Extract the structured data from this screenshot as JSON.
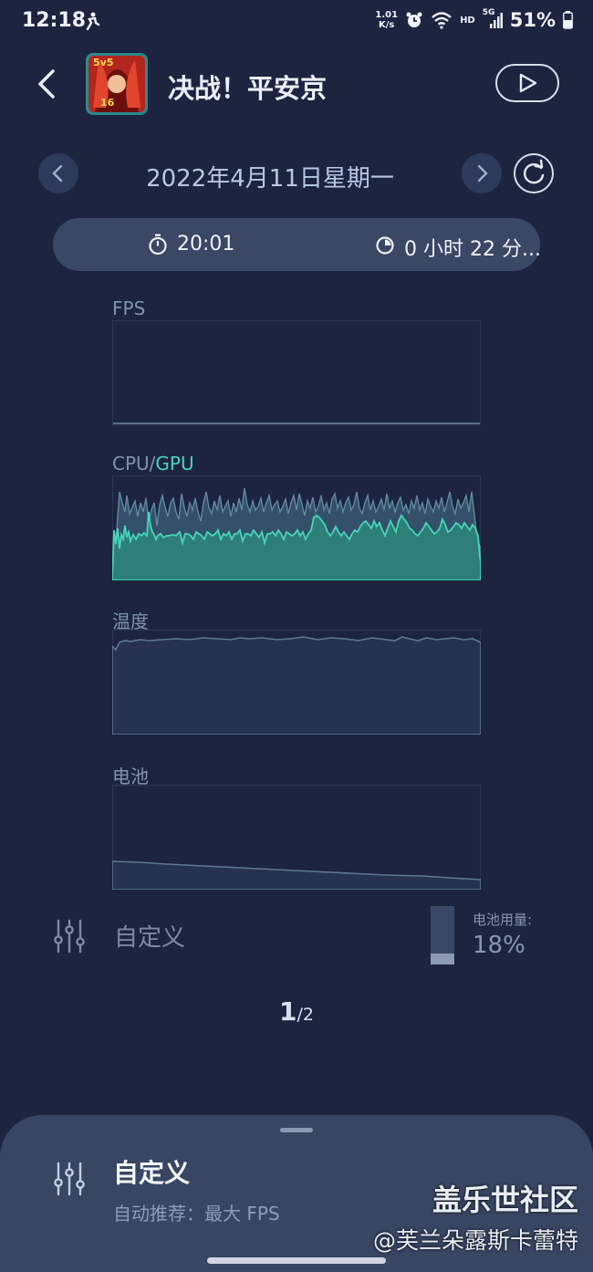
{
  "status_bar": {
    "time": "12:18",
    "net_speed_value": "1.01",
    "net_speed_unit": "K/s",
    "hd": "HD",
    "signal": "5G",
    "battery_percent": "51%"
  },
  "header": {
    "app_title": "决战！平安京",
    "icon_badge_top": "5v5",
    "icon_badge_bottom": "16"
  },
  "date_nav": {
    "date": "2022年4月11日星期一"
  },
  "session": {
    "start_time": "20:01",
    "duration": "0 小时 22 分..."
  },
  "charts": {
    "fps_label": "FPS",
    "cpu_label": "CPU",
    "gpu_separator": "/",
    "gpu_label": "GPU",
    "temp_label": "温度",
    "battery_label": "电池"
  },
  "customize": {
    "label": "自定义",
    "battery_usage_label": "电池用量:",
    "battery_usage_value": "18%",
    "battery_usage_fraction": 0.18
  },
  "pager": {
    "current": "1",
    "total": "/2"
  },
  "bottom_sheet": {
    "title": "自定义",
    "subtitle": "自动推荐：最大 FPS"
  },
  "watermark": {
    "brand": "盖乐世社区",
    "user": "@芙兰朵露斯卡蕾特"
  },
  "colors": {
    "background": "#1d2440",
    "accent_gpu": "#47d6bb",
    "cpu_line": "#5f8aa0",
    "pill": "#3a4765"
  }
}
